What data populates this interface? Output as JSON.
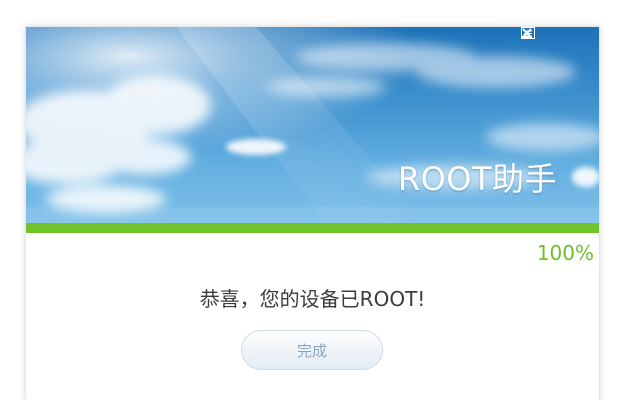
{
  "window": {
    "app_title": "ROOT助手",
    "controls": [
      {
        "name": "feedback-icon"
      },
      {
        "name": "minimize-icon"
      },
      {
        "name": "close-icon"
      }
    ]
  },
  "progress": {
    "value": 1.0,
    "label": "100%",
    "color": "#72c22a"
  },
  "result": {
    "message": "恭喜，您的设备已ROOT!",
    "done_label": "完成"
  },
  "colors": {
    "accent_green": "#72c22a",
    "percent_green": "#6cc12a",
    "sky_blue": "#3c8fcd"
  }
}
